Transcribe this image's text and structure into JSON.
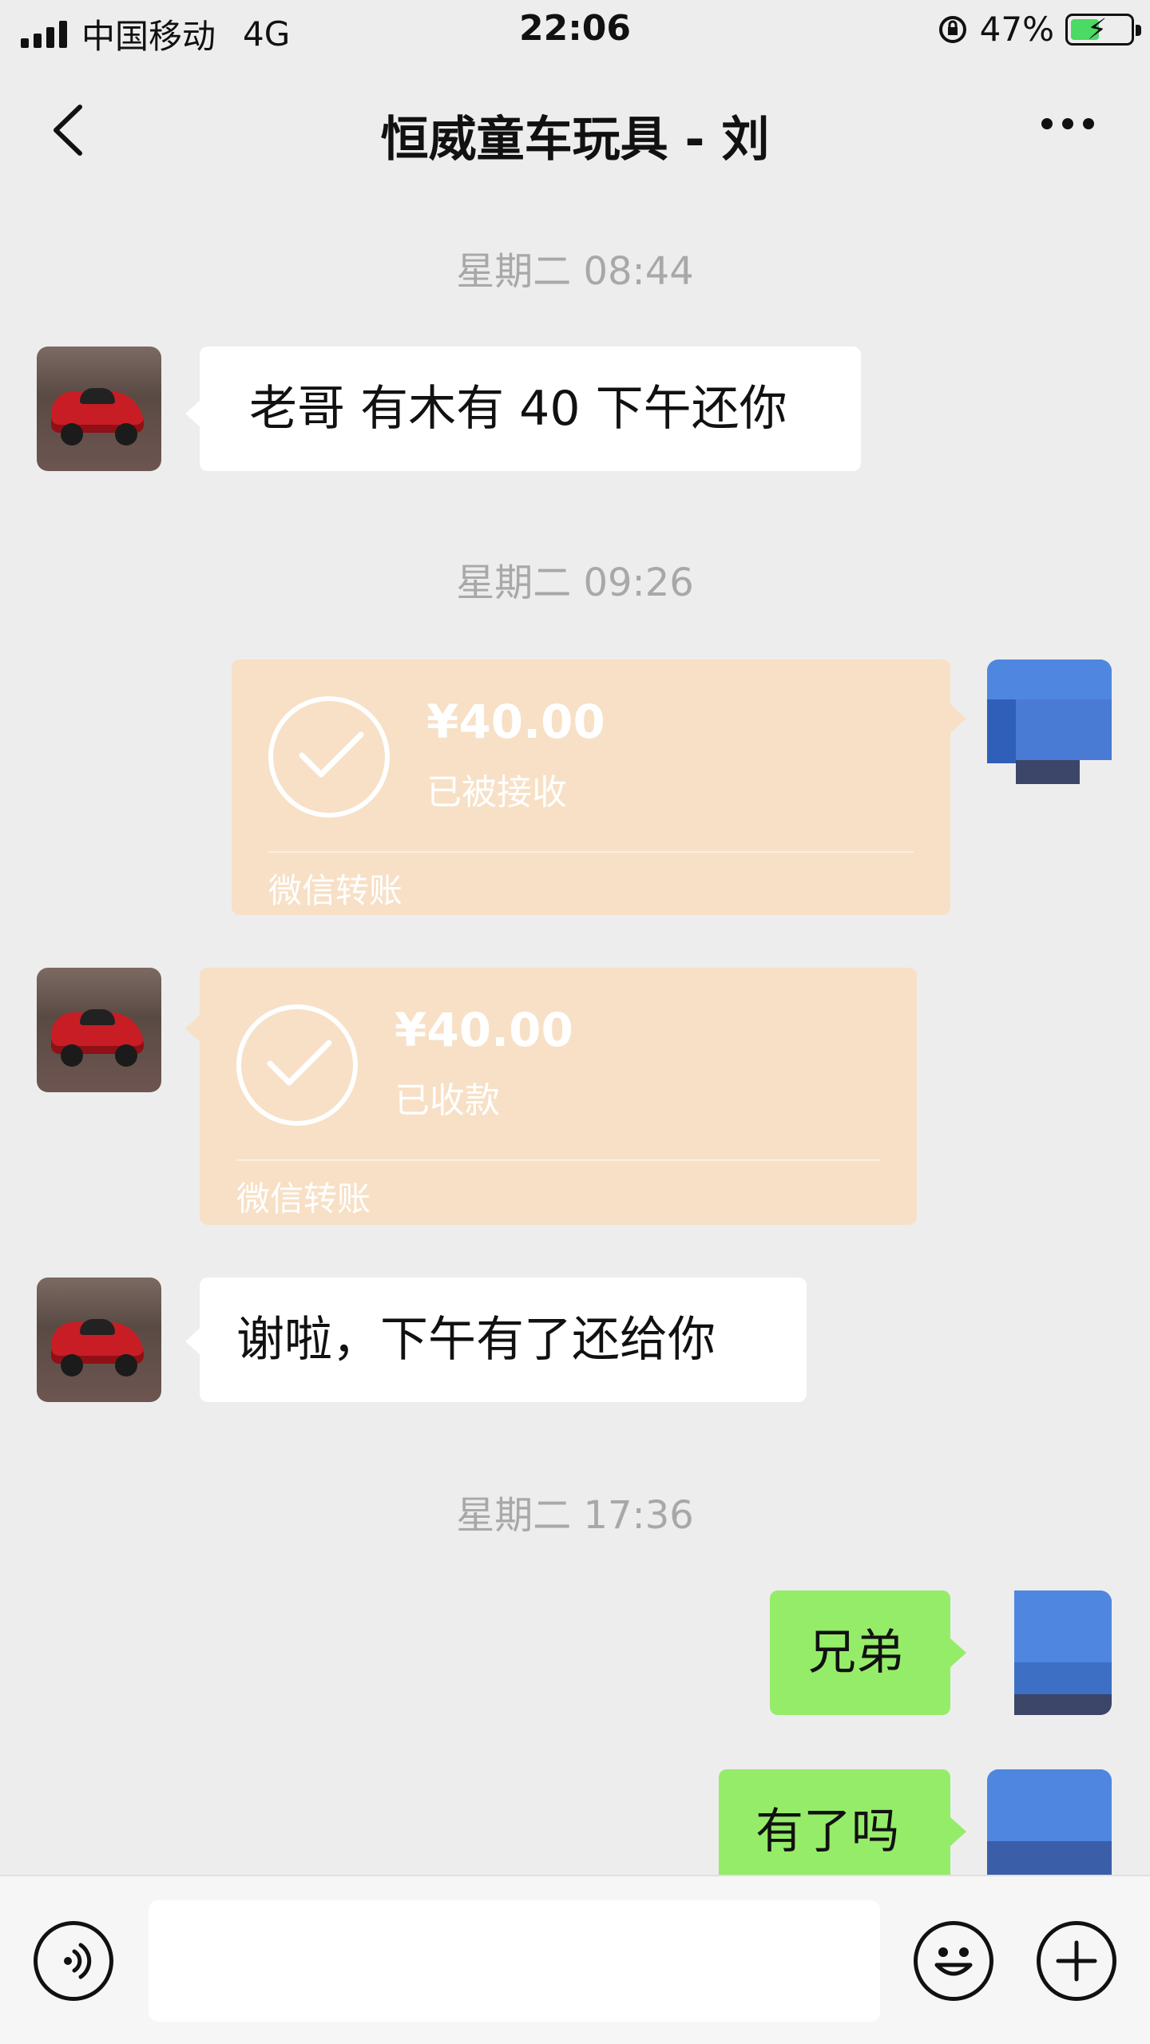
{
  "status_bar": {
    "carrier": "中国移动",
    "network": "4G",
    "time": "22:06",
    "battery_percent": "47%",
    "battery_level": 0.47,
    "battery_color": "#4cd964"
  },
  "nav": {
    "title": "恒威童车玩具 - 刘",
    "back_icon": "chevron-left-icon",
    "more_icon": "more-dots-icon"
  },
  "messages": {
    "t1": "星期二 08:44",
    "m1": "老哥 有木有 40 下午还你",
    "t2": "星期二 09:26",
    "transfer1": {
      "amount": "¥40.00",
      "status": "已被接收",
      "label": "微信转账"
    },
    "transfer2": {
      "amount": "¥40.00",
      "status": "已收款",
      "label": "微信转账"
    },
    "m2": "谢啦，下午有了还给你",
    "t3": "星期二 17:36",
    "m3": "兄弟",
    "m4": "有了吗"
  },
  "colors": {
    "background": "#ededed",
    "sent_bubble": "#95ec69",
    "received_bubble": "#ffffff",
    "transfer_card": "#f7e0c6"
  },
  "input_bar": {
    "voice_icon": "voice-icon",
    "emoji_icon": "emoji-icon",
    "plus_icon": "plus-icon",
    "text_value": ""
  }
}
